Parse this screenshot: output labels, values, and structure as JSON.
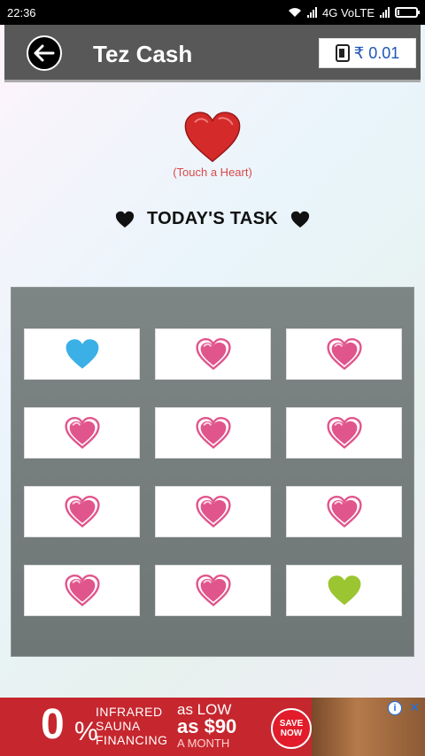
{
  "status_bar": {
    "time": "22:36",
    "network": "4G VoLTE"
  },
  "header": {
    "title": "Tez Cash",
    "balance": "₹ 0.01"
  },
  "hero": {
    "touch_label": "(Touch a Heart)",
    "task_title": "TODAY'S TASK"
  },
  "grid": {
    "hearts": [
      {
        "color": "#3ab0e6",
        "style": "filled"
      },
      {
        "color": "#e0558c",
        "style": "outlined"
      },
      {
        "color": "#e0558c",
        "style": "outlined"
      },
      {
        "color": "#e0558c",
        "style": "outlined"
      },
      {
        "color": "#e0558c",
        "style": "outlined"
      },
      {
        "color": "#e0558c",
        "style": "outlined"
      },
      {
        "color": "#e0558c",
        "style": "outlined"
      },
      {
        "color": "#e0558c",
        "style": "outlined"
      },
      {
        "color": "#e0558c",
        "style": "outlined"
      },
      {
        "color": "#e0558c",
        "style": "outlined"
      },
      {
        "color": "#e0558c",
        "style": "outlined"
      },
      {
        "color": "#9bc531",
        "style": "filled"
      }
    ]
  },
  "ad": {
    "zero": "0",
    "percent": "%",
    "line1": "INFRARED",
    "line2": "SAUNA",
    "line3": "FINANCING",
    "as_low": "as LOW",
    "as_price": "as $90",
    "per": "A MONTH",
    "cta1": "SAVE",
    "cta2": "NOW",
    "info": "i",
    "close": "✕"
  },
  "colors": {
    "header_bg": "#585858",
    "hero_heart": "#d42a2a",
    "balance_text": "#1e56b8",
    "ad_bg": "#c6262e"
  }
}
